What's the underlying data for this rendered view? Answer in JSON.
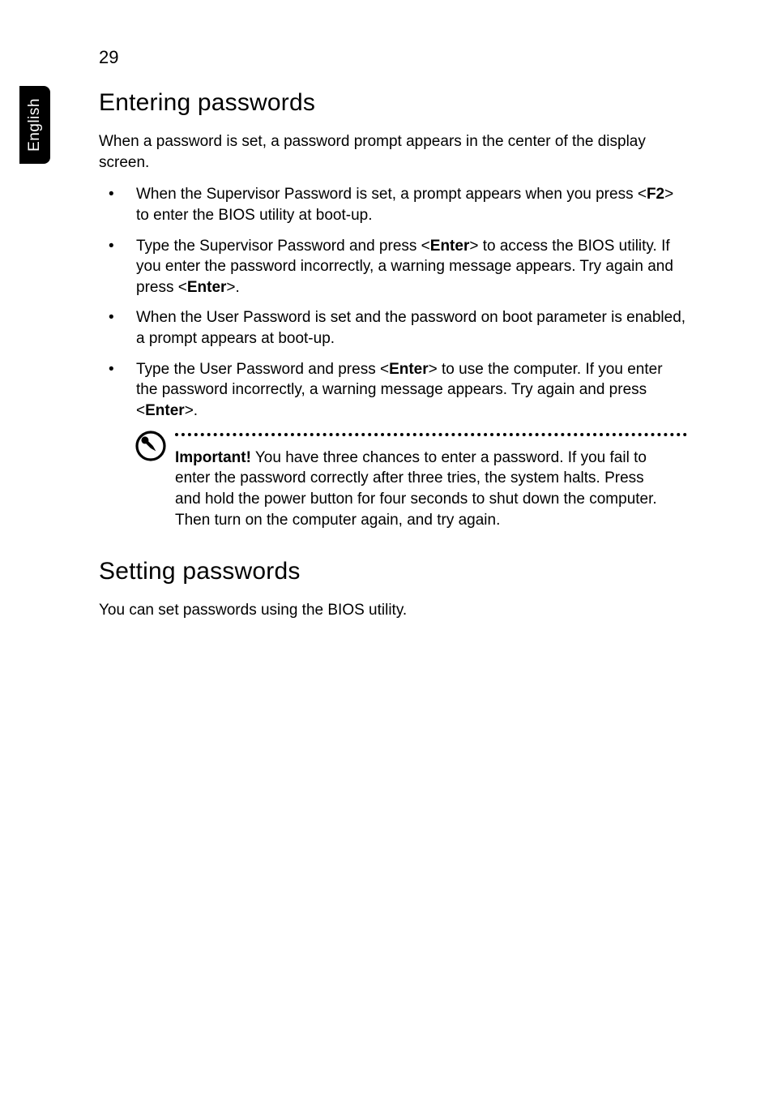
{
  "sideTab": "English",
  "pageNumber": "29",
  "sections": {
    "entering": {
      "heading": "Entering passwords",
      "intro": "When a password is set, a password prompt appears in the center of the display screen.",
      "bullets": {
        "b1a": "When the Supervisor Password is set, a prompt appears when you press <",
        "b1key": "F2",
        "b1b": "> to enter the BIOS utility at boot-up.",
        "b2a": "Type the Supervisor Password and press <",
        "b2k1": "Enter",
        "b2b": "> to access the BIOS utility. If you enter the password incorrectly, a warning message appears. Try again and press <",
        "b2k2": "Enter",
        "b2c": ">.",
        "b3": "When the User Password is set and the password on boot parameter is enabled, a prompt appears at boot-up.",
        "b4a": "Type the User Password and press <",
        "b4k1": "Enter",
        "b4b": "> to use the computer. If you enter the password incorrectly, a warning message appears. Try again and press <",
        "b4k2": "Enter",
        "b4c": ">."
      },
      "note": {
        "lead": "Important!",
        "body": " You have three chances to enter a password. If you fail to enter the password correctly after three tries, the system halts. Press and hold the power button for four seconds to shut down the computer. Then turn on the computer again, and try again."
      }
    },
    "setting": {
      "heading": "Setting passwords",
      "intro": "You can set passwords using the BIOS utility."
    }
  }
}
